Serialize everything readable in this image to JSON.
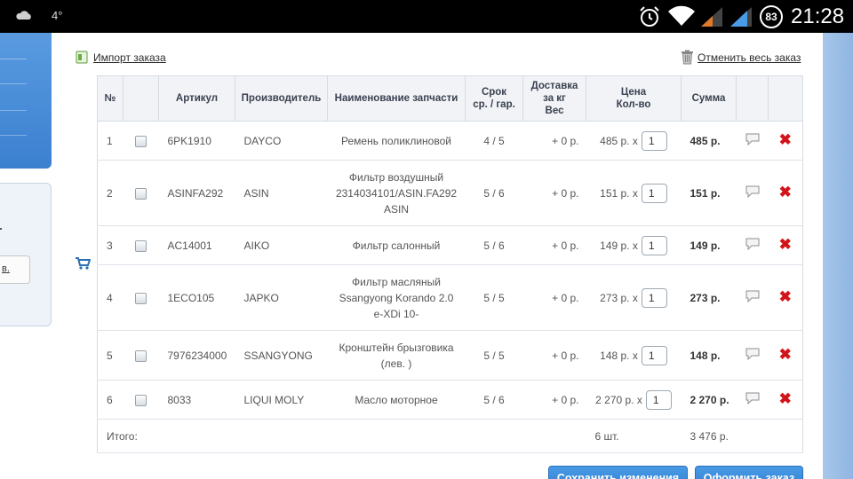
{
  "status_bar": {
    "temperature": "4°",
    "battery": "83",
    "time": "21:28"
  },
  "left_panel": {
    "button_fragment": "в."
  },
  "links": {
    "import": "Импорт заказа",
    "cancel_all": "Отменить весь заказ"
  },
  "table": {
    "headers": {
      "num": "№",
      "article": "Артикул",
      "maker": "Производитель",
      "name": "Наименование запчасти",
      "term_1": "Срок",
      "term_2": "ср. / гар.",
      "delivery_1": "Доставка",
      "delivery_2": "за кг",
      "delivery_3": "Вес",
      "price_1": "Цена",
      "price_2": "Кол-во",
      "sum": "Сумма"
    },
    "rows": [
      {
        "num": "1",
        "article": "6PK1910",
        "maker": "DAYCO",
        "name_1": "Ремень поликлиновой",
        "name_2": "",
        "name_3": "",
        "term": "4 / 5",
        "delivery": "+ 0 р.",
        "price": "485 р. x",
        "qty": "1",
        "sum": "485 р."
      },
      {
        "num": "2",
        "article": "ASINFA292",
        "maker": "ASIN",
        "name_1": "Фильтр воздушный",
        "name_2": "2314034101/ASIN.FA292",
        "name_3": "ASIN",
        "term": "5 / 6",
        "delivery": "+ 0 р.",
        "price": "151 р. x",
        "qty": "1",
        "sum": "151 р."
      },
      {
        "num": "3",
        "article": "AC14001",
        "maker": "AIKO",
        "name_1": "Фильтр салонный",
        "name_2": "",
        "name_3": "",
        "term": "5 / 6",
        "delivery": "+ 0 р.",
        "price": "149 р. x",
        "qty": "1",
        "sum": "149 р."
      },
      {
        "num": "4",
        "article": "1ECO105",
        "maker": "JAPKO",
        "name_1": "Фильтр масляный",
        "name_2": "Ssangyong Korando 2.0",
        "name_3": "e-XDi 10-",
        "term": "5 / 5",
        "delivery": "+ 0 р.",
        "price": "273 р. x",
        "qty": "1",
        "sum": "273 р."
      },
      {
        "num": "5",
        "article": "7976234000",
        "maker": "SSANGYONG",
        "name_1": "Кронштейн брызговика",
        "name_2": "(лев. )",
        "name_3": "",
        "term": "5 / 5",
        "delivery": "+ 0 р.",
        "price": "148 р. x",
        "qty": "1",
        "sum": "148 р."
      },
      {
        "num": "6",
        "article": "8033",
        "maker": "LIQUI MOLY",
        "name_1": "Масло моторное",
        "name_2": "",
        "name_3": "",
        "term": "5 / 6",
        "delivery": "+ 0 р.",
        "price": "2 270 р. x",
        "qty": "1",
        "sum": "2 270 р."
      }
    ],
    "total": {
      "label": "Итого:",
      "count": "6 шт.",
      "sum": "3 476 р."
    }
  },
  "buttons": {
    "save": "Сохранить изменения",
    "order": "Оформить заказ"
  },
  "colors": {
    "accent": "#3b86d8",
    "delete": "#d2141a",
    "header_bg": "#f1f3f6"
  }
}
